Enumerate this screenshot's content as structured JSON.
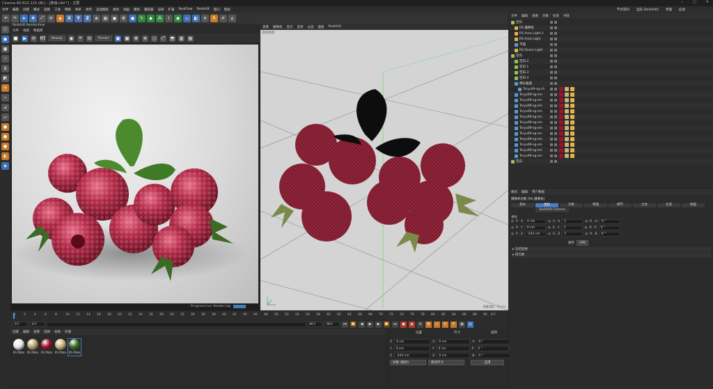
{
  "window": {
    "title": "Cinema 4D R21.115 (RC) - [玻璃.c4d *] - 主要",
    "controls": [
      "–",
      "□",
      "✕"
    ]
  },
  "menubar": {
    "items": [
      "文件",
      "编辑",
      "创建",
      "模式",
      "选择",
      "工具",
      "网格",
      "样条",
      "体积",
      "运动图形",
      "角色",
      "动画",
      "模拟",
      "跟踪器",
      "渲染",
      "扩展",
      "RealFlow",
      "Redshift",
      "窗口",
      "帮助"
    ],
    "right": [
      "节点空间",
      "当前 (Redshift)",
      "界面",
      "启动"
    ]
  },
  "render_view": {
    "title": "Redshift RenderView",
    "menu": [
      "文件",
      "视图",
      "数据库"
    ],
    "dropdown_mode": "Beauty",
    "dropdown_render": "Render",
    "status": "Progressive Rendering",
    "status_badge": ""
  },
  "viewport": {
    "menu": [
      "查看",
      "摄像机",
      "显示",
      "选项",
      "过滤",
      "面板",
      "Redshift"
    ],
    "label": "透视视图",
    "corner_label": "网格间距 : 10 cm"
  },
  "timeline": {
    "ticks": [
      "0",
      "2",
      "4",
      "6",
      "8",
      "10",
      "12",
      "14",
      "16",
      "18",
      "20",
      "22",
      "24",
      "26",
      "28",
      "30",
      "32",
      "34",
      "36",
      "38",
      "40",
      "42",
      "44",
      "46",
      "48",
      "50",
      "52",
      "54",
      "56",
      "58",
      "60",
      "62",
      "64",
      "66",
      "68",
      "70",
      "72",
      "74",
      "76",
      "78",
      "80",
      "82",
      "84",
      "86",
      "88",
      "90"
    ],
    "start_frame": "0 F",
    "current_frame": "0 F",
    "end_frame": "90 F",
    "max_frame": "90 F",
    "right_frame": "0 F"
  },
  "materials": {
    "menu": [
      "创建",
      "编辑",
      "查看",
      "选择",
      "材质",
      "纹理"
    ],
    "items": [
      {
        "label": "RS Mate",
        "color": "#e8e8e8"
      },
      {
        "label": "RS Mate",
        "color": "#b8a070"
      },
      {
        "label": "RS Mate",
        "color": "#a3102a"
      },
      {
        "label": "RS Mate",
        "color": "#c9b27a"
      },
      {
        "label": "RS Mate",
        "color": "#3c6b2a"
      }
    ]
  },
  "coordinates": {
    "headers": [
      "位置",
      "尺寸",
      "旋转"
    ],
    "rows": [
      {
        "axis": "X",
        "pos": "0 cm",
        "size": "0 cm",
        "rot_axis": "H",
        "rot": "0 °"
      },
      {
        "axis": "Y",
        "pos": "0 cm",
        "size": "0 cm",
        "rot_axis": "P",
        "rot": "0 °"
      },
      {
        "axis": "Z",
        "pos": "-243 cm",
        "size": "0 cm",
        "rot_axis": "B",
        "rot": "0 °"
      }
    ],
    "mode": "对象 (相对)",
    "size_mode": "绝对尺寸",
    "apply": "应用"
  },
  "object_manager": {
    "menu": [
      "文件",
      "编辑",
      "查看",
      "对象",
      "标签",
      "书签"
    ],
    "rows": [
      {
        "name": "空白",
        "color": "#9ac15a",
        "indent": 0
      },
      {
        "name": "RS 摄像机",
        "color": "#e0b64b",
        "indent": 1
      },
      {
        "name": "RS Area Light.1",
        "color": "#e0b64b",
        "indent": 1
      },
      {
        "name": "RS Area Light",
        "color": "#e0b64b",
        "indent": 1
      },
      {
        "name": "平面",
        "color": "#5a9ad8",
        "indent": 1
      },
      {
        "name": "RS Dome Light",
        "color": "#e0b64b",
        "indent": 1
      },
      {
        "name": "空白",
        "color": "#9ac15a",
        "indent": 0
      },
      {
        "name": "空白.2",
        "color": "#9ac15a",
        "indent": 1
      },
      {
        "name": "空白.1",
        "color": "#9ac15a",
        "indent": 1
      },
      {
        "name": "空白.3",
        "color": "#9ac15a",
        "indent": 1
      },
      {
        "name": "空白.4",
        "color": "#9ac15a",
        "indent": 1
      },
      {
        "name": "细分曲面",
        "color": "#5a9ad8",
        "indent": 1
      },
      {
        "name": "Tsryu09-sg-ch",
        "color": "#5a9ad8",
        "indent": 2
      },
      {
        "name": "Tsryu09-sg-sm",
        "color": "#5a9ad8",
        "indent": 1
      },
      {
        "name": "Tsryu09-sg-sm",
        "color": "#5a9ad8",
        "indent": 1
      },
      {
        "name": "Tsryu09-sg-sm",
        "color": "#5a9ad8",
        "indent": 1
      },
      {
        "name": "Tsryu09-sg-sm",
        "color": "#5a9ad8",
        "indent": 1
      },
      {
        "name": "Tsryu09-sg-sm",
        "color": "#5a9ad8",
        "indent": 1
      },
      {
        "name": "Tsryu09-sg-sm",
        "color": "#5a9ad8",
        "indent": 1
      },
      {
        "name": "Tsryu09-sg-sm",
        "color": "#5a9ad8",
        "indent": 1
      },
      {
        "name": "Tsryu09-sg-sm",
        "color": "#5a9ad8",
        "indent": 1
      },
      {
        "name": "Tsryu09-sg-sm",
        "color": "#5a9ad8",
        "indent": 1
      },
      {
        "name": "Tsryu09-sg-sm",
        "color": "#5a9ad8",
        "indent": 1
      },
      {
        "name": "Tsryu09-sg-sm",
        "color": "#5a9ad8",
        "indent": 1
      },
      {
        "name": "Tsryu09-sg-sm",
        "color": "#5a9ad8",
        "indent": 1
      },
      {
        "name": "空白",
        "color": "#9ac15a",
        "indent": 0
      }
    ]
  },
  "attributes": {
    "menu": [
      "模式",
      "编辑",
      "用户数据"
    ],
    "title": "摄像机对象 [RS 摄像机]",
    "tabs": [
      "基本",
      "坐标",
      "对象",
      "物理",
      "细节",
      "立体",
      "合成",
      "球面",
      "Redshift Camera"
    ],
    "active_tab": "坐标",
    "section": "坐标",
    "rows": [
      {
        "p": "P . X",
        "pv": "0 cm",
        "s": "S . X",
        "sv": "1",
        "r": "R . H",
        "rv": "0 °"
      },
      {
        "p": "P . Y",
        "pv": "0 cm",
        "s": "S . Y",
        "sv": "1",
        "r": "R . P",
        "rv": "0 °"
      },
      {
        "p": "P . Z",
        "pv": "-243 cm",
        "s": "S . Z",
        "sv": "1",
        "r": "R . B",
        "rv": "0 °"
      }
    ],
    "order_label": "顺序",
    "order_value": "HPB",
    "collapsed": [
      "冻结变换",
      "四元数"
    ]
  }
}
